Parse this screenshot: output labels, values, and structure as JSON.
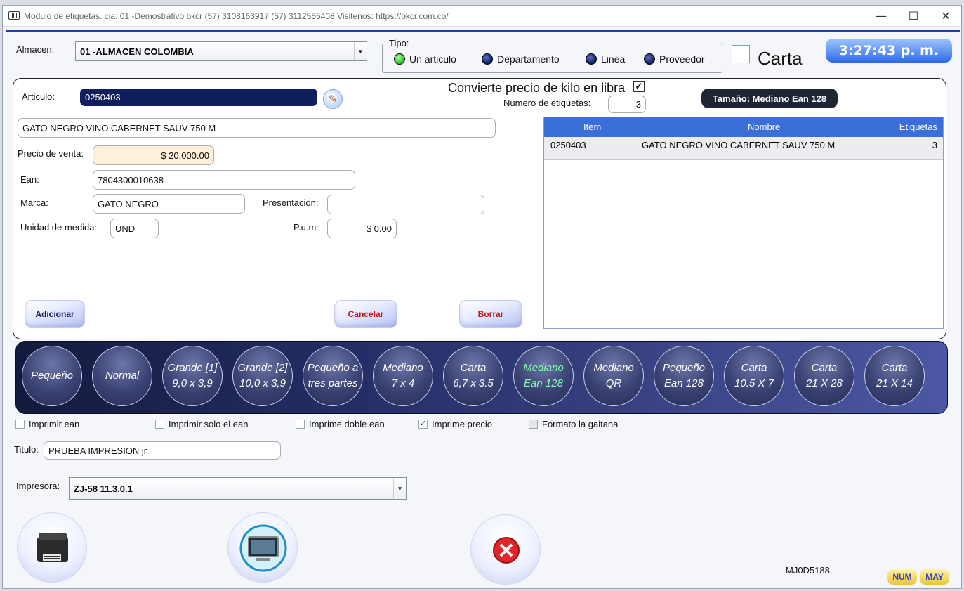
{
  "window": {
    "title": "Modulo de etiquetas. cia: 01  -Demostrativo bkcr          (57) 3108163917  (57) 3112555408  Visitenos: https://bkcr.com.co/",
    "minimize": "—",
    "maximize": "☐",
    "close": "✕"
  },
  "header": {
    "almacen_label": "Almacen:",
    "almacen_value": "01   -ALMACEN COLOMBIA",
    "tipo_label": "Tipo:",
    "tipo_options": [
      "Un articulo",
      "Departamento",
      "Linea",
      "Proveedor"
    ],
    "tipo_selected": "Un articulo",
    "carta_label": "Carta",
    "clock": "3:27:43 p. m."
  },
  "form": {
    "articulo_label": "Articulo:",
    "articulo_value": "0250403",
    "descripcion": "GATO NEGRO VINO CABERNET SAUV 750 M",
    "precio_label": "Precio de venta:",
    "precio_value": "$ 20,000.00",
    "ean_label": "Ean:",
    "ean_value": "7804300010638",
    "marca_label": "Marca:",
    "marca_value": "GATO NEGRO",
    "presentacion_label": "Presentacion:",
    "presentacion_value": "",
    "unidad_label": "Unidad de medida:",
    "unidad_value": "UND",
    "pum_label": "P.u.m:",
    "pum_value": "$ 0.00",
    "convierte_label": "Convierte precio de kilo en libra",
    "numero_label": "Numero de etiquetas:",
    "numero_value": "3",
    "tamano": "Tamaño: Mediano Ean 128",
    "btn_adicionar": "Adicionar",
    "btn_cancelar": "Cancelar",
    "btn_borrar": "Borrar"
  },
  "table": {
    "headers": [
      "Item",
      "Nombre",
      "Etiquetas"
    ],
    "rows": [
      {
        "item": "0250403",
        "nombre": "GATO NEGRO VINO CABERNET SAUV 750 M",
        "etiquetas": "3"
      }
    ]
  },
  "sizes": [
    [
      "Pequeño"
    ],
    [
      "Normal"
    ],
    [
      "Grande [1]",
      "9,0 x 3,9"
    ],
    [
      "Grande [2]",
      "10,0 x 3,9"
    ],
    [
      "Pequeño a",
      "tres partes"
    ],
    [
      "Mediano",
      "7 x 4"
    ],
    [
      "Carta",
      "6,7 x 3.5"
    ],
    [
      "Mediano",
      "Ean 128"
    ],
    [
      "Mediano",
      "QR"
    ],
    [
      "Pequeño",
      "Ean 128"
    ],
    [
      "Carta",
      "10.5 X 7"
    ],
    [
      "Carta",
      "21 X 28"
    ],
    [
      "Carta",
      "21 X 14"
    ]
  ],
  "options": {
    "imprimir_ean": "Imprimir ean",
    "imprimir_solo_ean": "Imprimir solo el ean",
    "imprime_doble_ean": "Imprime doble ean",
    "imprime_precio": "Imprime precio",
    "formato_gaitana": "Formato la gaitana"
  },
  "titulo_label": "Titulo:",
  "titulo_value": "PRUEBA IMPRESION jr",
  "impresora_label": "Impresora:",
  "impresora_value": "ZJ-58 11.3.0.1",
  "footer": {
    "code": "MJ0D5188",
    "num": "NUM",
    "may": "MAY"
  },
  "colors": {
    "accent": "#1f3fb8",
    "clock": "#2d6ae8",
    "table_header": "#3a6fd8"
  }
}
